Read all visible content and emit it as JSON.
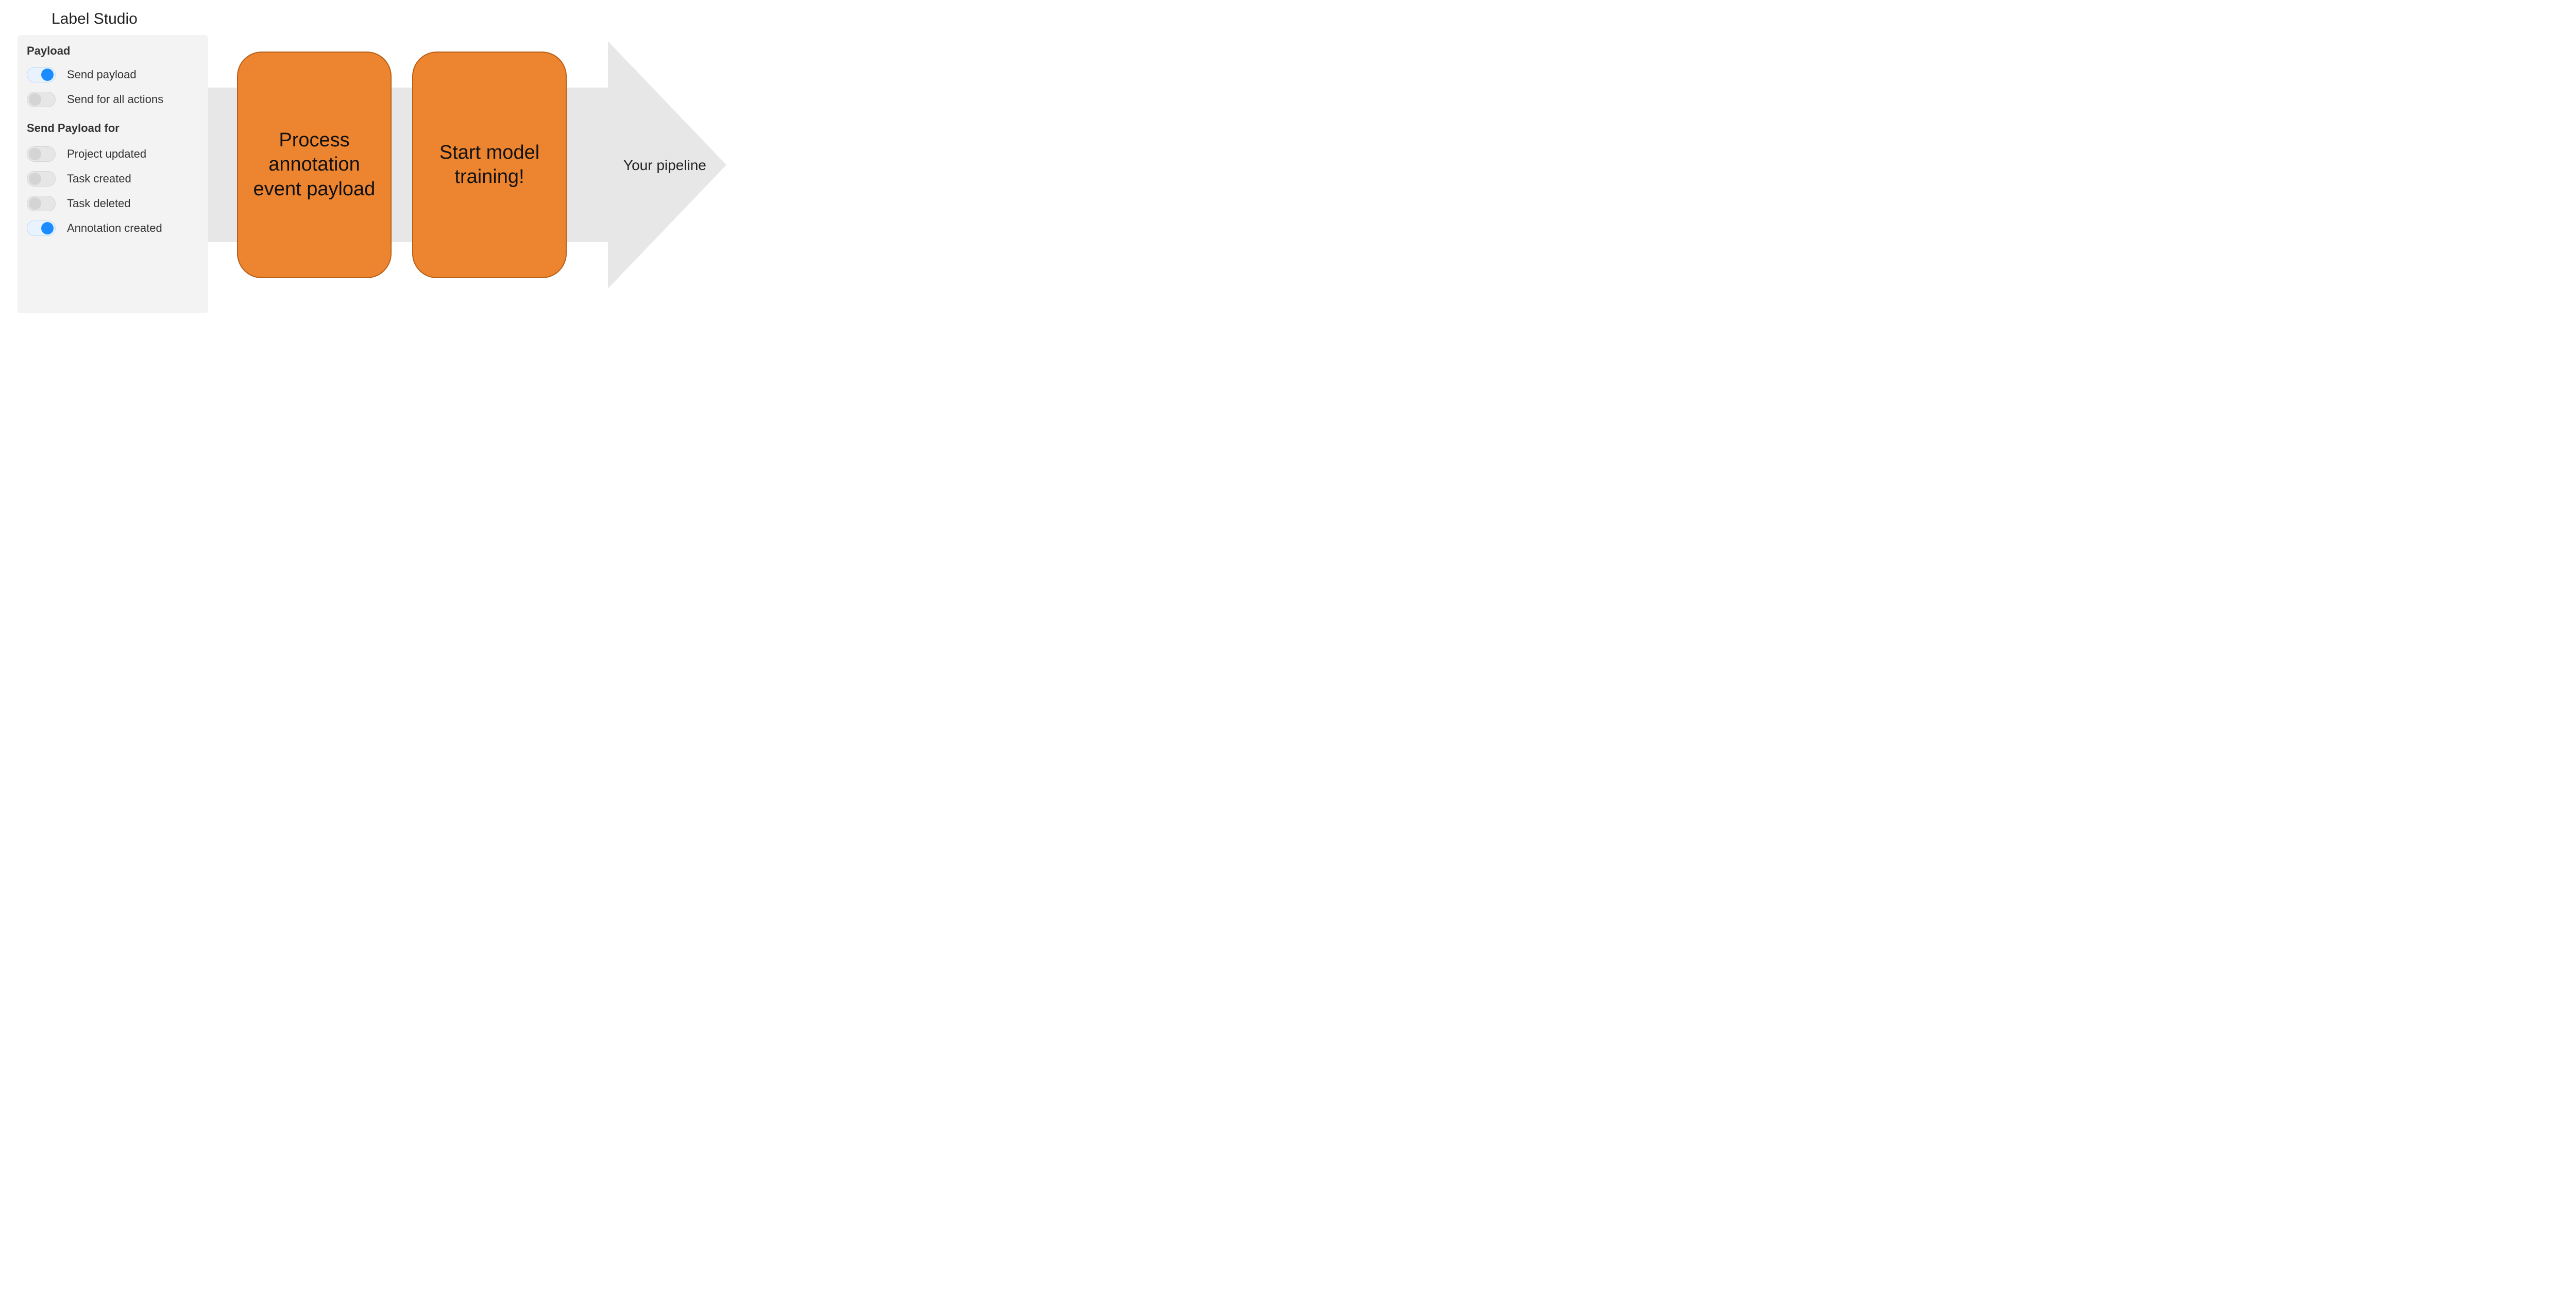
{
  "title": "Label Studio",
  "panel": {
    "heading": "Payload",
    "toggles_top": [
      {
        "label": "Send payload",
        "on": true
      },
      {
        "label": "Send for all actions",
        "on": false
      }
    ],
    "subheading": "Send Payload for",
    "toggles_bottom": [
      {
        "label": "Project updated",
        "on": false
      },
      {
        "label": "Task created",
        "on": false
      },
      {
        "label": "Task deleted",
        "on": false
      },
      {
        "label": "Annotation created",
        "on": true
      }
    ]
  },
  "steps": {
    "one": "Process annotation event payload",
    "two": "Start model training!"
  },
  "pipeline_label": "Your pipeline"
}
